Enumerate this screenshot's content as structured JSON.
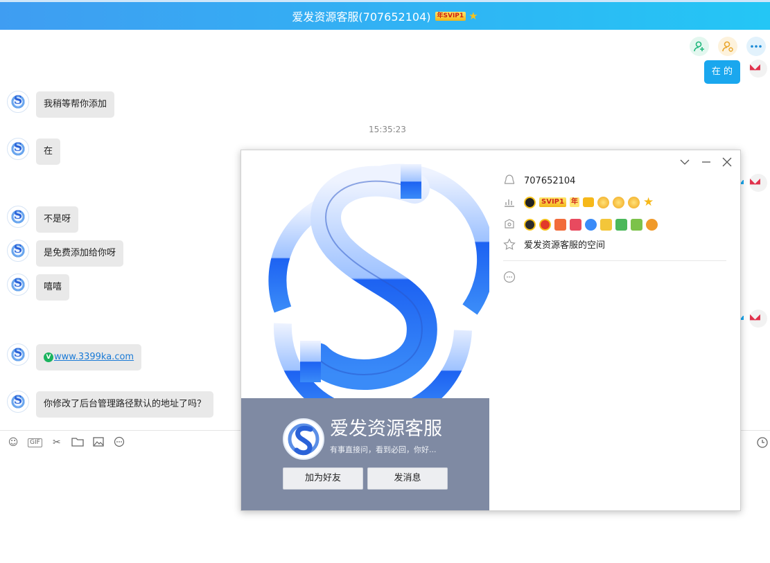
{
  "window": {
    "title": "爱发资源客服(707652104)",
    "vip_badge": "年SVIP1",
    "title_star": "★"
  },
  "header_icons": [
    "add-friend-icon",
    "invite-icon",
    "more-icon"
  ],
  "chat": {
    "messages": [
      {
        "side": "right",
        "text": "在 的"
      },
      {
        "side": "left",
        "text": "我稍等帮你添加"
      },
      {
        "side": "left",
        "text": "在"
      },
      {
        "side": "left",
        "text": "不是呀"
      },
      {
        "side": "left",
        "text": "是免费添加给你呀"
      },
      {
        "side": "left",
        "text": "嘻嘻"
      },
      {
        "side": "left",
        "text": "www.3399ka.com",
        "link": true
      },
      {
        "side": "left",
        "text": "你修改了后台管理路径默认的地址了吗？"
      }
    ],
    "timestamp": "15:35:23",
    "verified_mark": "V"
  },
  "toolbar": {
    "icons": [
      "emoji-icon",
      "gif-icon",
      "scissors-icon",
      "folder-icon",
      "image-icon",
      "more-icon",
      "history-clock-icon"
    ],
    "gif_label": "GIF"
  },
  "profile_card": {
    "qq_number": "707652104",
    "vip_text": "SVIP1",
    "vip_year": "年",
    "space_link": "爱发资源客服的空间",
    "name": "爱发资源客服",
    "signature": "有事直接问，看到必回，你好...",
    "add_friend_button": "加为好友",
    "send_message_button": "发消息",
    "colors": {
      "bottom_panel": "#7f8aa3",
      "title_gradient_start": "#3f9df2",
      "title_gradient_end": "#24c6f5",
      "bubble_self": "#1aa7ee",
      "bubble_other": "#e9e9e9"
    }
  }
}
